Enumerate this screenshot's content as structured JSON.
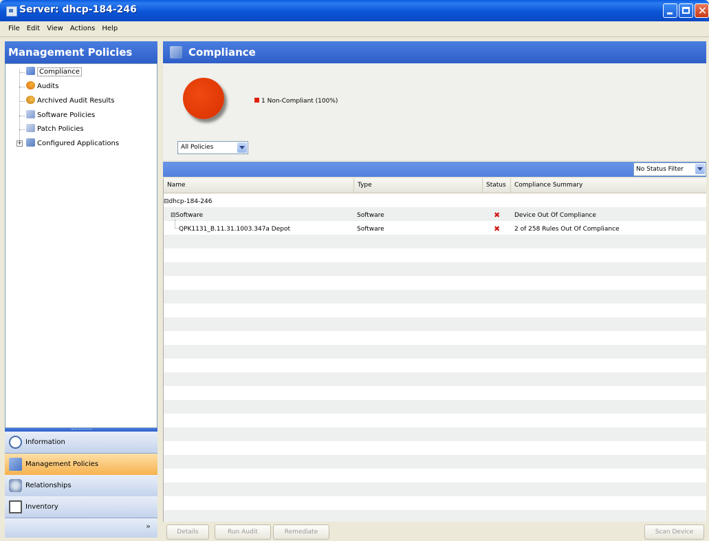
{
  "window": {
    "title": "Server: dhcp-184-246"
  },
  "menu": [
    "File",
    "Edit",
    "View",
    "Actions",
    "Help"
  ],
  "sidebar": {
    "title": "Management Policies",
    "tree": [
      {
        "label": "Compliance",
        "icon": "compliance-icon",
        "selected": true
      },
      {
        "label": "Audits",
        "icon": "audit-icon"
      },
      {
        "label": "Archived Audit Results",
        "icon": "archived-audit-icon"
      },
      {
        "label": "Software Policies",
        "icon": "software-policy-icon"
      },
      {
        "label": "Patch Policies",
        "icon": "patch-policy-icon"
      },
      {
        "label": "Configured Applications",
        "icon": "configured-apps-icon",
        "expandable": true
      }
    ],
    "nav": [
      {
        "label": "Information",
        "icon": "information-icon"
      },
      {
        "label": "Management Policies",
        "icon": "management-policies-icon",
        "active": true
      },
      {
        "label": "Relationships",
        "icon": "relationships-icon"
      },
      {
        "label": "Inventory",
        "icon": "inventory-icon"
      }
    ],
    "more": "»"
  },
  "main": {
    "title": "Compliance",
    "pie": {
      "legend": "1 Non-Compliant (100%)",
      "color": "#e02000",
      "non_compliant_percent": 100
    },
    "policy_select": "All Policies",
    "status_filter": "No Status Filter",
    "columns": [
      "Name",
      "Type",
      "Status",
      "Compliance Summary"
    ],
    "rows": [
      {
        "name": "dhcp-184-246",
        "type": "",
        "status": "",
        "summary": "",
        "expander": "⊟"
      },
      {
        "name": "Software",
        "type": "Software",
        "status": "✖",
        "summary": "Device Out Of Compliance",
        "expander": "⊟"
      },
      {
        "name": "QPK1131_B.11.31.1003.347a Depot",
        "type": "Software",
        "status": "✖",
        "summary": "2 of 258 Rules Out Of Compliance",
        "expander": ""
      }
    ],
    "buttons": {
      "details": "Details",
      "run_audit": "Run Audit",
      "remediate": "Remediate",
      "scan_device": "Scan Device"
    }
  }
}
